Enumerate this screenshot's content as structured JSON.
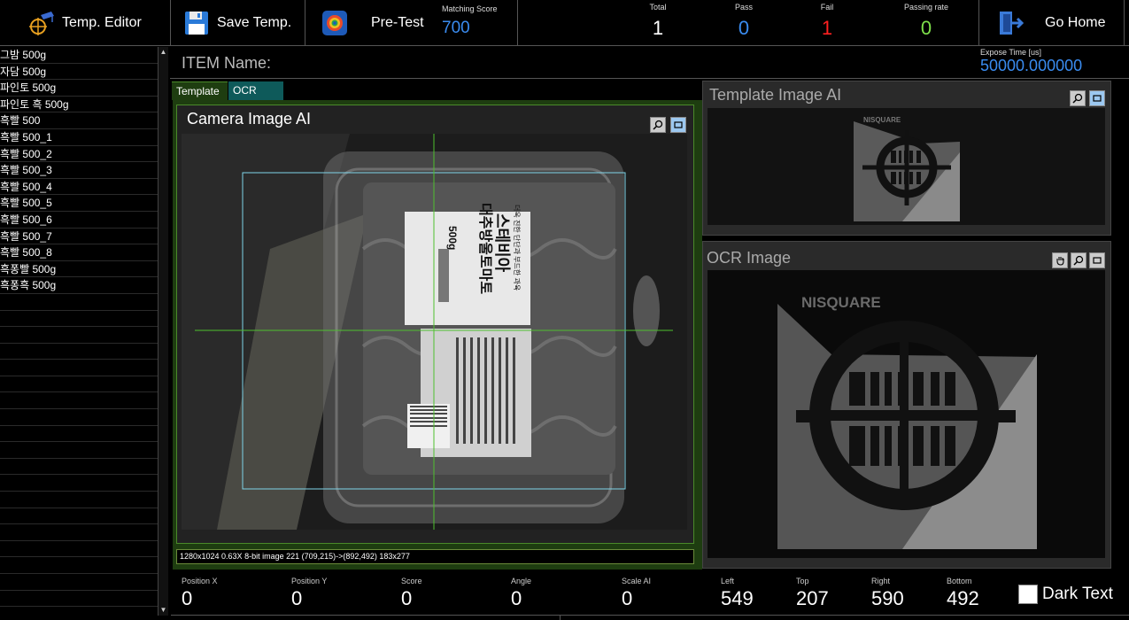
{
  "toolbar": {
    "temp_editor_label": "Temp. Editor",
    "save_temp_label": "Save Temp.",
    "pre_test_label": "Pre-Test",
    "matching_score_caption": "Matching Score",
    "matching_score_value": "700",
    "go_home_label": "Go Home"
  },
  "stats": {
    "total": {
      "caption": "Total",
      "value": "1",
      "color": "#ffffff"
    },
    "pass": {
      "caption": "Pass",
      "value": "0",
      "color": "#3a8cf0"
    },
    "fail": {
      "caption": "Fail",
      "value": "1",
      "color": "#ff2020"
    },
    "rate": {
      "caption": "Passing rate",
      "value": "0",
      "color": "#7ee04a"
    }
  },
  "item_list": [
    "그밤 500g",
    "자담 500g",
    "파인토 500g",
    "파인토 흑 500g",
    "흑빨 500",
    "흑빨 500_1",
    "흑빨 500_2",
    "흑빨 500_3",
    "흑빨 500_4",
    "흑빨 500_5",
    "흑빨 500_6",
    "흑빨 500_7",
    "흑빨 500_8",
    "흑퐁빨 500g",
    "흑퐁흑 500g"
  ],
  "item_name_label": "ITEM Name:",
  "expose": {
    "caption": "Expose Time [us]",
    "value": "50000.000000"
  },
  "tabs": {
    "template": "Template",
    "ocr": "OCR"
  },
  "camera_title": "Camera Image AI",
  "status_line": "1280x1024 0.63X 8-bit image 221    (709,215)->(892,492)    183x277",
  "position": {
    "x": {
      "caption": "Position X",
      "value": "0"
    },
    "y": {
      "caption": "Position Y",
      "value": "0"
    },
    "score": {
      "caption": "Score",
      "value": "0"
    },
    "angle": {
      "caption": "Angle",
      "value": "0"
    },
    "scale": {
      "caption": "Scale AI",
      "value": "0"
    }
  },
  "roi": {
    "left": {
      "caption": "Left",
      "value": "549"
    },
    "top": {
      "caption": "Top",
      "value": "207"
    },
    "right": {
      "caption": "Right",
      "value": "590"
    },
    "bottom": {
      "caption": "Bottom",
      "value": "492"
    }
  },
  "template_image_title": "Template Image AI",
  "ocr_image_title": "OCR Image",
  "logo_text": "NISQUARE",
  "dark_text_label": "Dark Text",
  "product_label": {
    "weight": "500g",
    "name_line1": "스테비아",
    "name_line2": "대추방울토마토",
    "tagline": "더욱 진한 단단과 부드한 과육"
  }
}
